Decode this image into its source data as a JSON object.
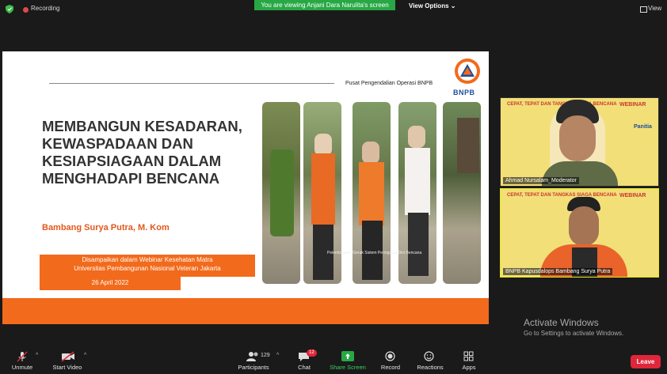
{
  "top_bar": {
    "recording_label": "Recording",
    "banner": "You are viewing Anjani Dara Narulita's screen",
    "view_options": "View Options ⌄",
    "view_label": "View"
  },
  "slide": {
    "org_label": "Pusat Pengendalian Operasi BNPB",
    "logo_text": "BNPB",
    "title": "MEMBANGUN KESADARAN, KEWASPADAAN DAN KESIAPSIAGAAN DALAM MENGHADAPI BENCANA",
    "speaker": "Bambang Surya Putra, M. Kom",
    "delivered_line1": "Disampaikan dalam Webinar Kesehatan Matra",
    "delivered_line2": "Universitas Pembangunan Nasional Veteran Jakarta",
    "date": "26 April 2022",
    "photo_caption": "Pelembagaan Gerak Sistem Peringatan Dini Bencana"
  },
  "participants_tiles": [
    {
      "name": "Ahmad Nursalam_Moderator",
      "webinar_text": "WEBINAR",
      "role": "Panitia"
    },
    {
      "name": "BNPB Kapusdalops Bambang Surya Putra",
      "webinar_text": "WEBINAR"
    }
  ],
  "tile_headline": "CEPAT, TEPAT DAN TANGKAS SIAGA BENCANA",
  "activation": {
    "title": "Activate Windows",
    "subtitle": "Go to Settings to activate Windows."
  },
  "toolbar": {
    "unmute": "Unmute",
    "start_video": "Start Video",
    "participants": "Participants",
    "participants_count": "129",
    "chat": "Chat",
    "chat_badge": "12",
    "share_screen": "Share Screen",
    "record": "Record",
    "reactions": "Reactions",
    "apps": "Apps",
    "leave": "Leave"
  },
  "colors": {
    "accent_green": "#27a844",
    "slide_orange": "#f26a1b",
    "leave_red": "#e0263a",
    "bnpb_blue": "#1f4d9c"
  }
}
